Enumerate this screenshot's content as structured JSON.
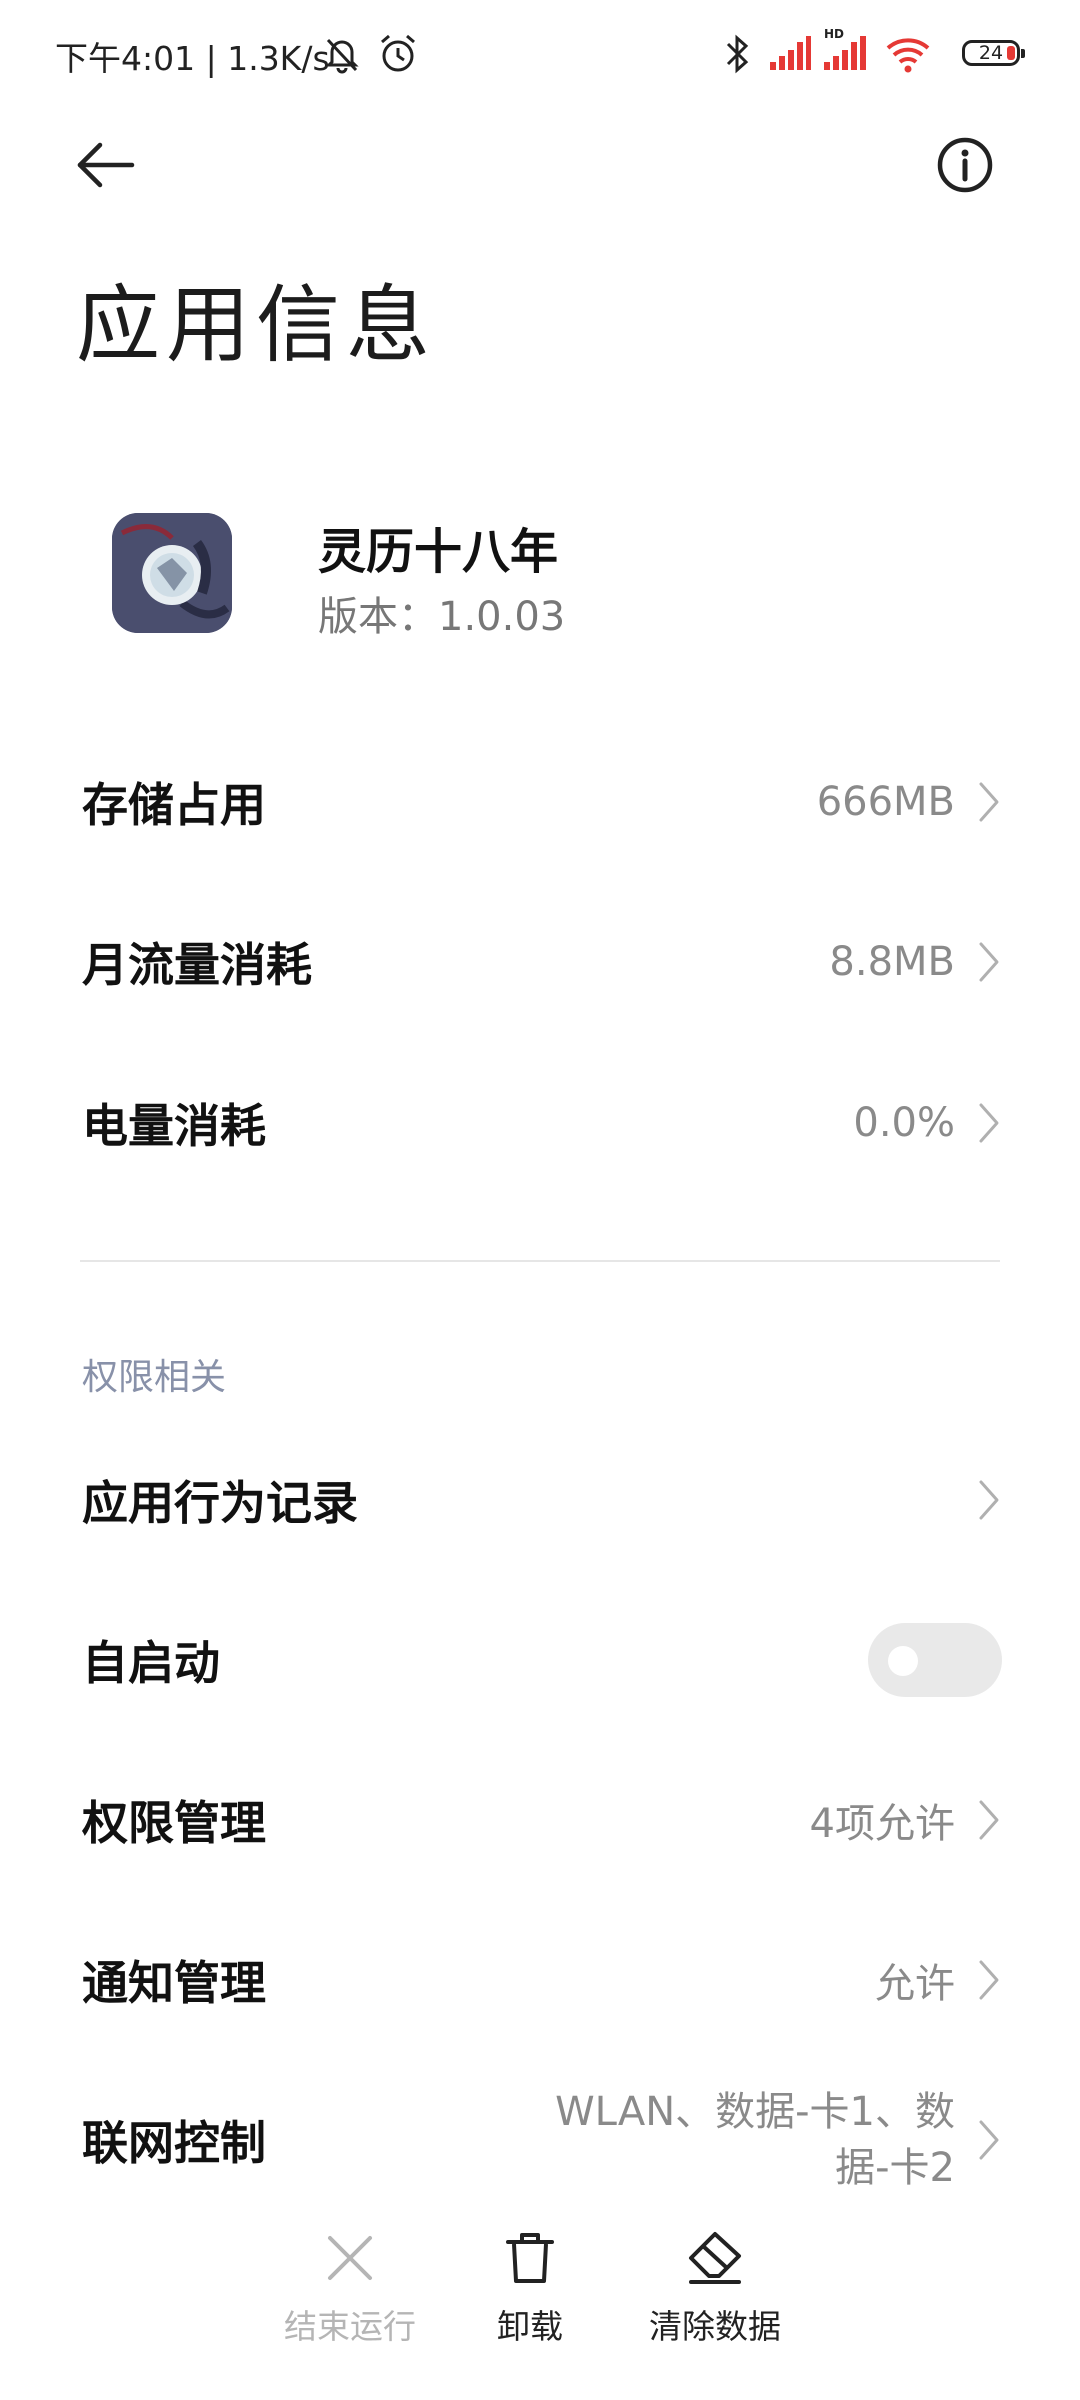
{
  "status_bar": {
    "time_text": "下午4:01 | 1.3K/s",
    "battery_level": "24",
    "icons": [
      "mute-notifications-icon",
      "alarm-icon",
      "bluetooth-icon",
      "signal-sim1-icon",
      "signal-sim2-hd-icon",
      "wifi-icon",
      "battery-icon"
    ],
    "colors": {
      "signal_weak": "#e53935",
      "text": "#222222"
    }
  },
  "header": {
    "back_icon": "back-arrow-icon",
    "info_icon": "info-icon",
    "title": "应用信息"
  },
  "app": {
    "name": "灵历十八年",
    "version": "版本：1.0.03",
    "icon": "app-icon"
  },
  "usage_rows": [
    {
      "label": "存储占用",
      "value": "666MB"
    },
    {
      "label": "月流量消耗",
      "value": "8.8MB"
    },
    {
      "label": "电量消耗",
      "value": "0.0%"
    }
  ],
  "permissions": {
    "section_title": "权限相关",
    "rows": [
      {
        "label": "应用行为记录",
        "value": ""
      },
      {
        "label": "自启动",
        "toggle_on": false
      },
      {
        "label": "权限管理",
        "value": "4项允许"
      },
      {
        "label": "通知管理",
        "value": "允许"
      },
      {
        "label": "联网控制",
        "value": "WLAN、数据-卡1、数据-卡2"
      }
    ]
  },
  "bottom_actions": [
    {
      "label": "结束运行",
      "icon": "close-icon",
      "enabled": false
    },
    {
      "label": "卸载",
      "icon": "trash-icon",
      "enabled": true
    },
    {
      "label": "清除数据",
      "icon": "eraser-icon",
      "enabled": true
    }
  ],
  "theme": {
    "text_primary": "#111111",
    "text_secondary": "#8a8a8a",
    "section_header": "#8891a9",
    "toggle_off": "#e9e9e9",
    "disabled": "#b5b5b5"
  }
}
